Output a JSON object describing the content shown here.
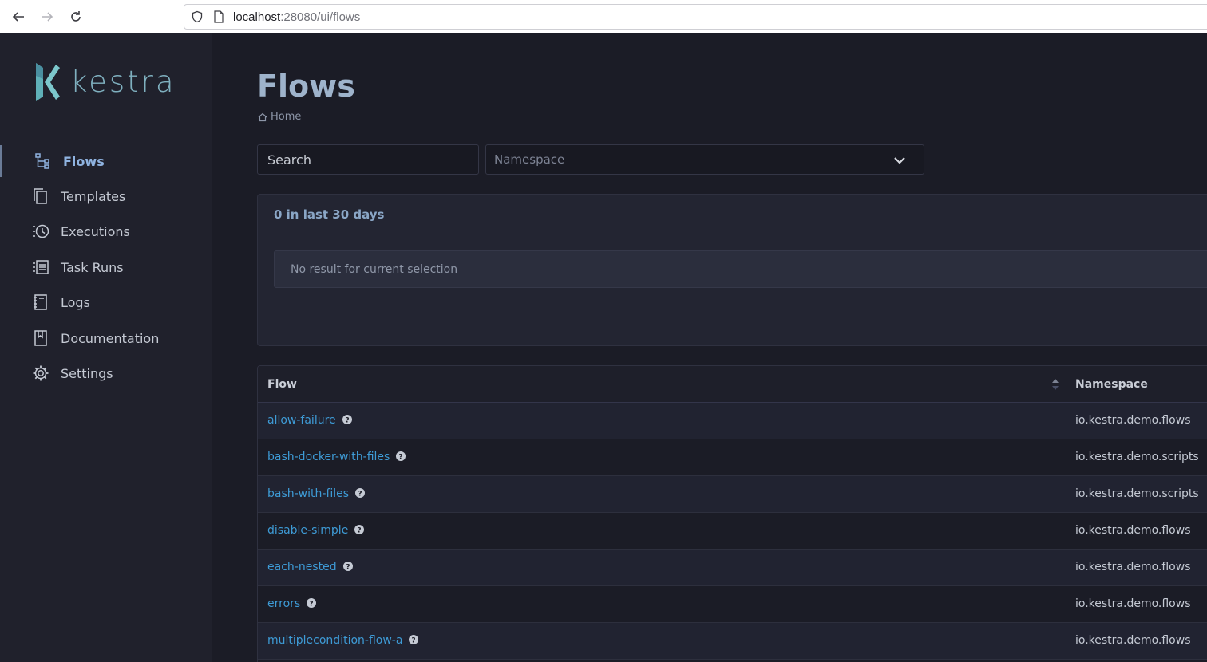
{
  "browser": {
    "url_host": "localhost",
    "url_rest": ":28080/ui/flows"
  },
  "brand": {
    "name": "kestra",
    "mark_color": "#5fb0b8"
  },
  "sidebar": {
    "items": [
      {
        "label": "Flows",
        "icon": "flows-tree-icon",
        "active": true
      },
      {
        "label": "Templates",
        "icon": "templates-copy-icon"
      },
      {
        "label": "Executions",
        "icon": "executions-history-icon"
      },
      {
        "label": "Task Runs",
        "icon": "task-runs-list-icon"
      },
      {
        "label": "Logs",
        "icon": "logs-notebook-icon"
      },
      {
        "label": "Documentation",
        "icon": "documentation-book-icon"
      },
      {
        "label": "Settings",
        "icon": "settings-gear-icon"
      }
    ]
  },
  "page": {
    "title": "Flows",
    "breadcrumb": "Home"
  },
  "filters": {
    "search_placeholder": "Search",
    "namespace_placeholder": "Namespace"
  },
  "stats": {
    "heading": "0 in last 30 days",
    "empty_message": "No result for current selection"
  },
  "table": {
    "columns": [
      "Flow",
      "Namespace"
    ],
    "rows": [
      {
        "flow": "allow-failure",
        "namespace": "io.kestra.demo.flows"
      },
      {
        "flow": "bash-docker-with-files",
        "namespace": "io.kestra.demo.scripts"
      },
      {
        "flow": "bash-with-files",
        "namespace": "io.kestra.demo.scripts"
      },
      {
        "flow": "disable-simple",
        "namespace": "io.kestra.demo.flows"
      },
      {
        "flow": "each-nested",
        "namespace": "io.kestra.demo.flows"
      },
      {
        "flow": "errors",
        "namespace": "io.kestra.demo.flows"
      },
      {
        "flow": "multiplecondition-flow-a",
        "namespace": "io.kestra.demo.flows"
      }
    ]
  },
  "colors": {
    "accent": "#8fb3e0",
    "link": "#3e9bd6",
    "sidebar_bg": "#20212c",
    "main_bg": "#1b1c26"
  }
}
